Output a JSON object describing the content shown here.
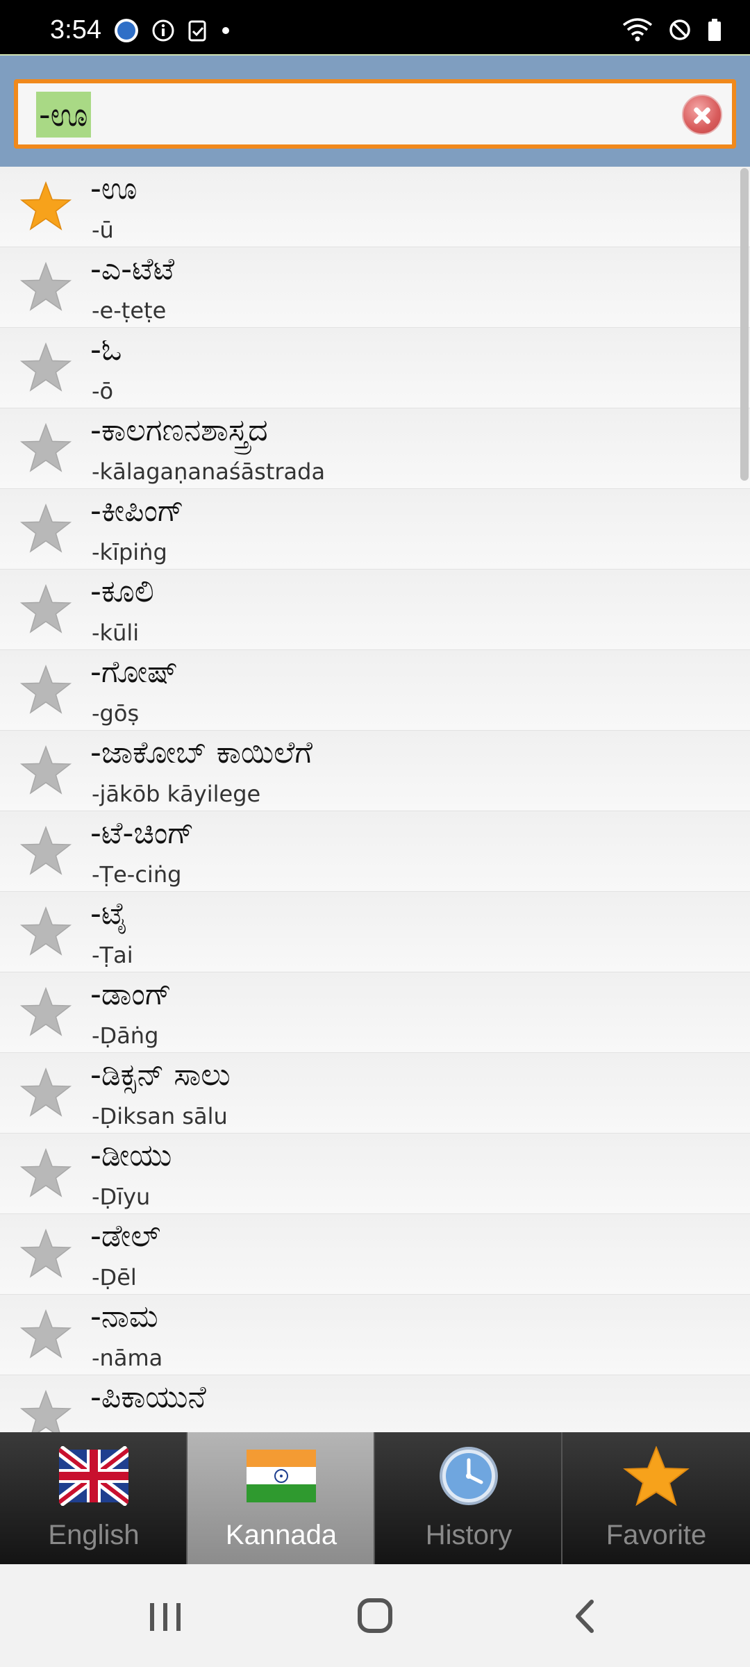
{
  "status_bar": {
    "time": "3:54"
  },
  "search": {
    "query": "-ಊ"
  },
  "colors": {
    "accent_orange": "#f0891c",
    "header_blue": "#7f9ec0",
    "highlight_green": "#a9d985",
    "star_gold": "#f7a21b",
    "star_gray": "#b8b8b8"
  },
  "words": [
    {
      "main": "-ಊ",
      "sub": "-ū",
      "favorite": true
    },
    {
      "main": "-ಎ-ಟೆಟೆ",
      "sub": "-e-ṭeṭe",
      "favorite": false
    },
    {
      "main": "-ಓ",
      "sub": "-ō",
      "favorite": false
    },
    {
      "main": "-ಕಾಲಗಣನಶಾಸ್ತ್ರದ",
      "sub": "-kālagaṇanaśāstrada",
      "favorite": false
    },
    {
      "main": "-ಕೀಪಿಂಗ್",
      "sub": "-kīpiṅg",
      "favorite": false
    },
    {
      "main": "-ಕೂಲಿ",
      "sub": "-kūli",
      "favorite": false
    },
    {
      "main": "-ಗೋಷ್",
      "sub": "-gōṣ",
      "favorite": false
    },
    {
      "main": "-ಜಾಕೋಬ್ ಕಾಯಿಲೆಗೆ",
      "sub": "-jākōb kāyilege",
      "favorite": false
    },
    {
      "main": "-ಟೆ-ಚಿಂಗ್",
      "sub": "-Ṭe-ciṅg",
      "favorite": false
    },
    {
      "main": "-ಟೈ",
      "sub": "-Ṭai",
      "favorite": false
    },
    {
      "main": "-ಡಾಂಗ್",
      "sub": "-Ḍāṅg",
      "favorite": false
    },
    {
      "main": "-ಡಿಕ್ಸನ್ ಸಾಲು",
      "sub": "-Ḍiksan sālu",
      "favorite": false
    },
    {
      "main": "-ಡೀಯು",
      "sub": "-Ḍīyu",
      "favorite": false
    },
    {
      "main": "-ಡೇಲ್",
      "sub": "-Ḍēl",
      "favorite": false
    },
    {
      "main": "-ನಾಮ",
      "sub": "-nāma",
      "favorite": false
    },
    {
      "main": "-ಪಿಕಾಯುನೆ",
      "sub": "",
      "favorite": false
    }
  ],
  "tabs": [
    {
      "label": "English",
      "icon": "uk-flag-icon",
      "active": false
    },
    {
      "label": "Kannada",
      "icon": "india-flag-icon",
      "active": true
    },
    {
      "label": "History",
      "icon": "clock-icon",
      "active": false
    },
    {
      "label": "Favorite",
      "icon": "star-icon",
      "active": false
    }
  ]
}
